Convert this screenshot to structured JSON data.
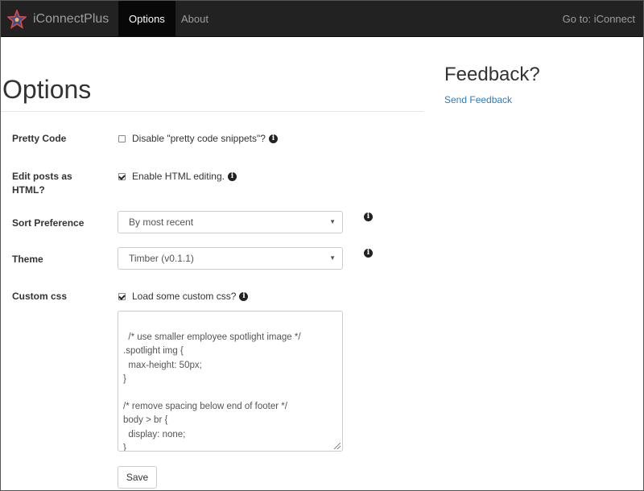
{
  "navbar": {
    "brand": "iConnectPlus",
    "items": [
      {
        "label": "Options",
        "active": true
      },
      {
        "label": "About",
        "active": false
      }
    ],
    "goto_label": "Go to: iConnect",
    "bg_color": "#222222"
  },
  "page": {
    "title": "Options"
  },
  "form": {
    "pretty_code": {
      "label": "Pretty Code",
      "checkbox_label": "Disable \"pretty code snippets\"?",
      "checked": false
    },
    "edit_html": {
      "label": "Edit posts as HTML?",
      "checkbox_label": "Enable HTML editing.",
      "checked": true
    },
    "sort_preference": {
      "label": "Sort Preference",
      "selected": "By most recent"
    },
    "theme": {
      "label": "Theme",
      "selected": "Timber (v0.1.1)"
    },
    "custom_css": {
      "label": "Custom css",
      "checkbox_label": "Load some custom css?",
      "checked": true,
      "value": "/* use smaller employee spotlight image */\n.spotlight img {\n  max-height: 50px;\n}\n\n/* remove spacing below end of footer */\nbody > br {\n  display: none;\n}"
    },
    "save_label": "Save"
  },
  "sidebar": {
    "title": "Feedback?",
    "link": "Send Feedback",
    "link_color": "#337ab7"
  }
}
